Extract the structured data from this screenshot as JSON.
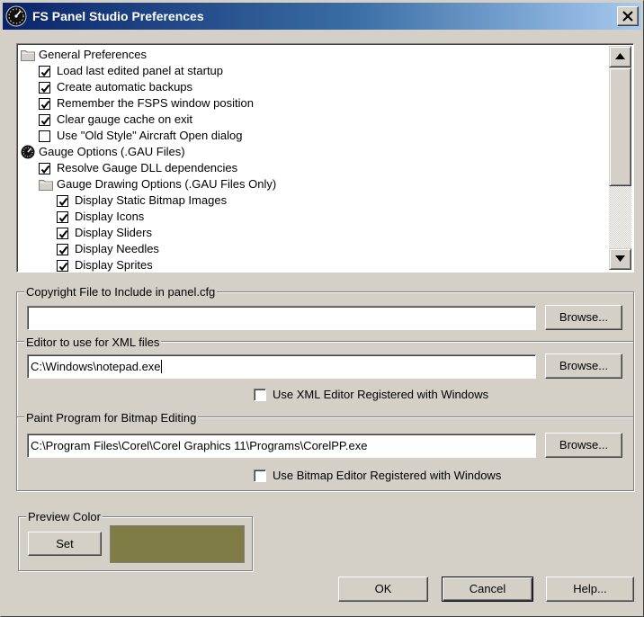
{
  "window": {
    "title": "FS Panel Studio Preferences",
    "close_label": "X"
  },
  "tree": {
    "items": [
      {
        "label": "General Preferences",
        "level": 0,
        "icon": "folder-icon",
        "checked": null
      },
      {
        "label": "Load last edited panel at startup",
        "level": 1,
        "checked": true
      },
      {
        "label": "Create automatic backups",
        "level": 1,
        "checked": true
      },
      {
        "label": "Remember the FSPS window position",
        "level": 1,
        "checked": true
      },
      {
        "label": "Clear gauge cache on exit",
        "level": 1,
        "checked": true
      },
      {
        "label": "Use \"Old Style\" Aircraft Open dialog",
        "level": 1,
        "checked": false
      },
      {
        "label": "Gauge Options (.GAU Files)",
        "level": 0,
        "icon": "gauge-icon",
        "checked": null
      },
      {
        "label": "Resolve Gauge DLL dependencies",
        "level": 1,
        "checked": true
      },
      {
        "label": "Gauge Drawing Options (.GAU Files Only)",
        "level": 1,
        "icon": "folder-icon",
        "checked": null
      },
      {
        "label": "Display Static Bitmap Images",
        "level": 2,
        "checked": true
      },
      {
        "label": "Display Icons",
        "level": 2,
        "checked": true
      },
      {
        "label": "Display Sliders",
        "level": 2,
        "checked": true
      },
      {
        "label": "Display Needles",
        "level": 2,
        "checked": true
      },
      {
        "label": "Display Sprites",
        "level": 2,
        "checked": true
      }
    ],
    "scroll_position": 0.0
  },
  "copyright": {
    "label": "Copyright File to Include in panel.cfg",
    "value": "",
    "browse_label": "Browse..."
  },
  "xml_editor": {
    "label": "Editor to use for XML files",
    "value": "C:\\Windows\\notepad.exe",
    "browse_label": "Browse...",
    "use_registered_label": "Use XML Editor Registered with Windows",
    "use_registered_checked": false
  },
  "paint_program": {
    "label": "Paint Program for Bitmap Editing",
    "value": "C:\\Program Files\\Corel\\Corel Graphics 11\\Programs\\CorelPP.exe",
    "browse_label": "Browse...",
    "use_registered_label": "Use Bitmap Editor Registered with Windows",
    "use_registered_checked": false
  },
  "preview_color": {
    "label": "Preview Color",
    "set_label": "Set",
    "color": "#7f7d45"
  },
  "footer": {
    "ok_label": "OK",
    "cancel_label": "Cancel",
    "help_label": "Help..."
  },
  "colors": {
    "titlebar_start": "#0a246a",
    "titlebar_end": "#a6caf0",
    "face": "#d4d0c8"
  }
}
